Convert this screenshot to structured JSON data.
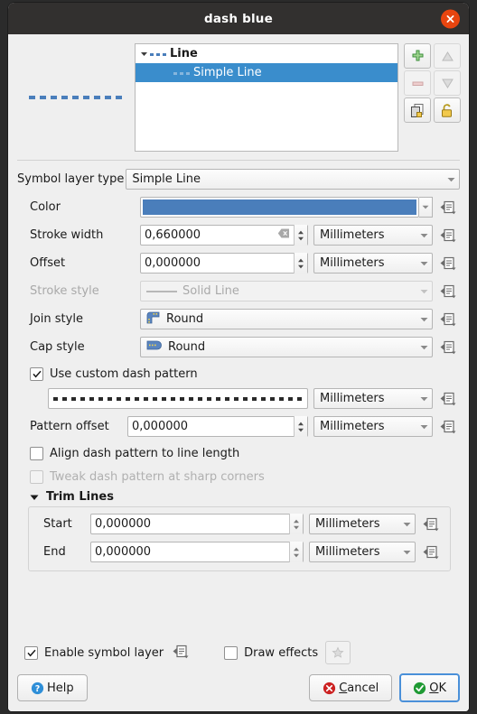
{
  "window": {
    "title": "dash blue",
    "close_icon": "close-icon"
  },
  "preview": {
    "line_color": "#4a7ebb",
    "dash_count": 10
  },
  "tree": {
    "rows": [
      {
        "label": "Line",
        "selected": false,
        "level": 0,
        "icon": "dash-line-icon"
      },
      {
        "label": "Simple Line",
        "selected": true,
        "level": 1,
        "icon": "dash-line-icon"
      }
    ]
  },
  "side_tools": [
    {
      "name": "add-symbol-layer-button",
      "icon": "plus-icon",
      "enabled": true
    },
    {
      "name": "move-up-button",
      "icon": "arrow-up-icon",
      "enabled": false
    },
    {
      "name": "remove-symbol-layer-button",
      "icon": "minus-icon",
      "enabled": false
    },
    {
      "name": "move-down-button",
      "icon": "arrow-down-icon",
      "enabled": false
    },
    {
      "name": "duplicate-symbol-layer-button",
      "icon": "copy-icon",
      "enabled": true
    },
    {
      "name": "lock-layer-button",
      "icon": "unlock-icon",
      "enabled": true
    }
  ],
  "symbol_layer_type": {
    "label": "Symbol layer type",
    "value": "Simple Line"
  },
  "fields": {
    "color": {
      "label": "Color",
      "value": "#4a7ebb"
    },
    "stroke_width": {
      "label": "Stroke width",
      "value": "0,660000",
      "unit": "Millimeters",
      "has_clear": true
    },
    "offset": {
      "label": "Offset",
      "value": "0,000000",
      "unit": "Millimeters"
    },
    "stroke_style": {
      "label": "Stroke style",
      "value": "Solid Line",
      "disabled": true
    },
    "join_style": {
      "label": "Join style",
      "value": "Round"
    },
    "cap_style": {
      "label": "Cap style",
      "value": "Round"
    },
    "pattern_offset": {
      "label": "Pattern offset",
      "value": "0,000000",
      "unit": "Millimeters"
    },
    "dash_pattern": {
      "unit": "Millimeters"
    }
  },
  "checks": {
    "use_custom_dash": {
      "label": "Use custom dash pattern",
      "checked": true,
      "disabled": false
    },
    "align_dash": {
      "label": "Align dash pattern to line length",
      "checked": false,
      "disabled": false
    },
    "tweak_dash": {
      "label": "Tweak dash pattern at sharp corners",
      "checked": false,
      "disabled": true
    },
    "enable_symbol_layer": {
      "label": "Enable symbol layer",
      "checked": true,
      "disabled": false
    },
    "draw_effects": {
      "label": "Draw effects",
      "checked": false,
      "disabled": false
    }
  },
  "trim_lines": {
    "title": "Trim Lines",
    "start": {
      "label": "Start",
      "value": "0,000000",
      "unit": "Millimeters"
    },
    "end": {
      "label": "End",
      "value": "0,000000",
      "unit": "Millimeters"
    }
  },
  "buttons": {
    "help": "Help",
    "cancel_pre": "",
    "cancel_u": "C",
    "cancel_post": "ancel",
    "ok_pre": "",
    "ok_u": "O",
    "ok_post": "K"
  },
  "colors": {
    "titlebar": "#32302f",
    "close": "#e8450f",
    "selection": "#3a8dcc",
    "accent_blue": "#4a7ebb",
    "ok_green": "#1f9a34",
    "cancel_red": "#cc2222",
    "help_blue": "#2f8fd8"
  }
}
